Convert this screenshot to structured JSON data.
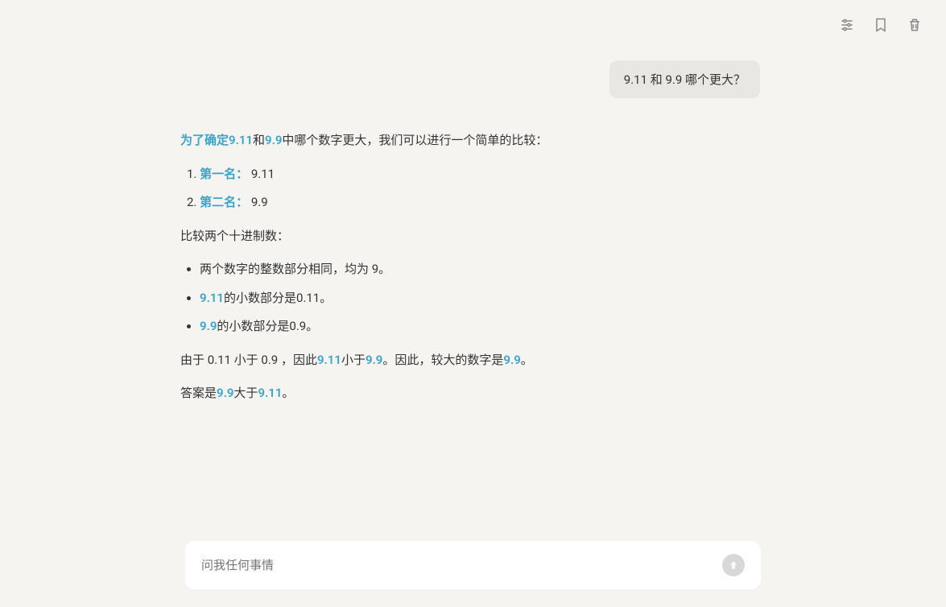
{
  "toolbar": {
    "settings_icon": "settings",
    "bookmark_icon": "bookmark",
    "trash_icon": "trash"
  },
  "user_message": "9.11 和 9.9 哪个更大？",
  "assistant": {
    "intro": {
      "prefix_highlight": "为了确定9.11",
      "mid1": "和",
      "mid_highlight": "9.9",
      "suffix": "中哪个数字更大，我们可以进行一个简单的比较："
    },
    "list1": [
      {
        "num": "1. ",
        "label": "第一名：",
        "value": " 9.11"
      },
      {
        "num": "2. ",
        "label": "第二名：",
        "value": " 9.9"
      }
    ],
    "compare_heading": "比较两个十进制数：",
    "bullets": [
      {
        "text": "两个数字的整数部分相同，均为 9。"
      },
      {
        "highlight": "9.11",
        "text": "的小数部分是0.11。"
      },
      {
        "highlight": "9.9",
        "text": "的小数部分是0.9。"
      }
    ],
    "conclusion1": {
      "prefix": "由于 0.11 小于 0.9 ，因此",
      "h1": "9.11",
      "mid": "小于",
      "h2": "9.9",
      "mid2": "。因此，较大的数字是",
      "h3": "9.9",
      "suffix": "。"
    },
    "conclusion2": {
      "prefix": "答案是",
      "h1": "9.9",
      "mid": "大于",
      "h2": "9.11",
      "suffix": "。"
    }
  },
  "input": {
    "placeholder": "问我任何事情"
  }
}
